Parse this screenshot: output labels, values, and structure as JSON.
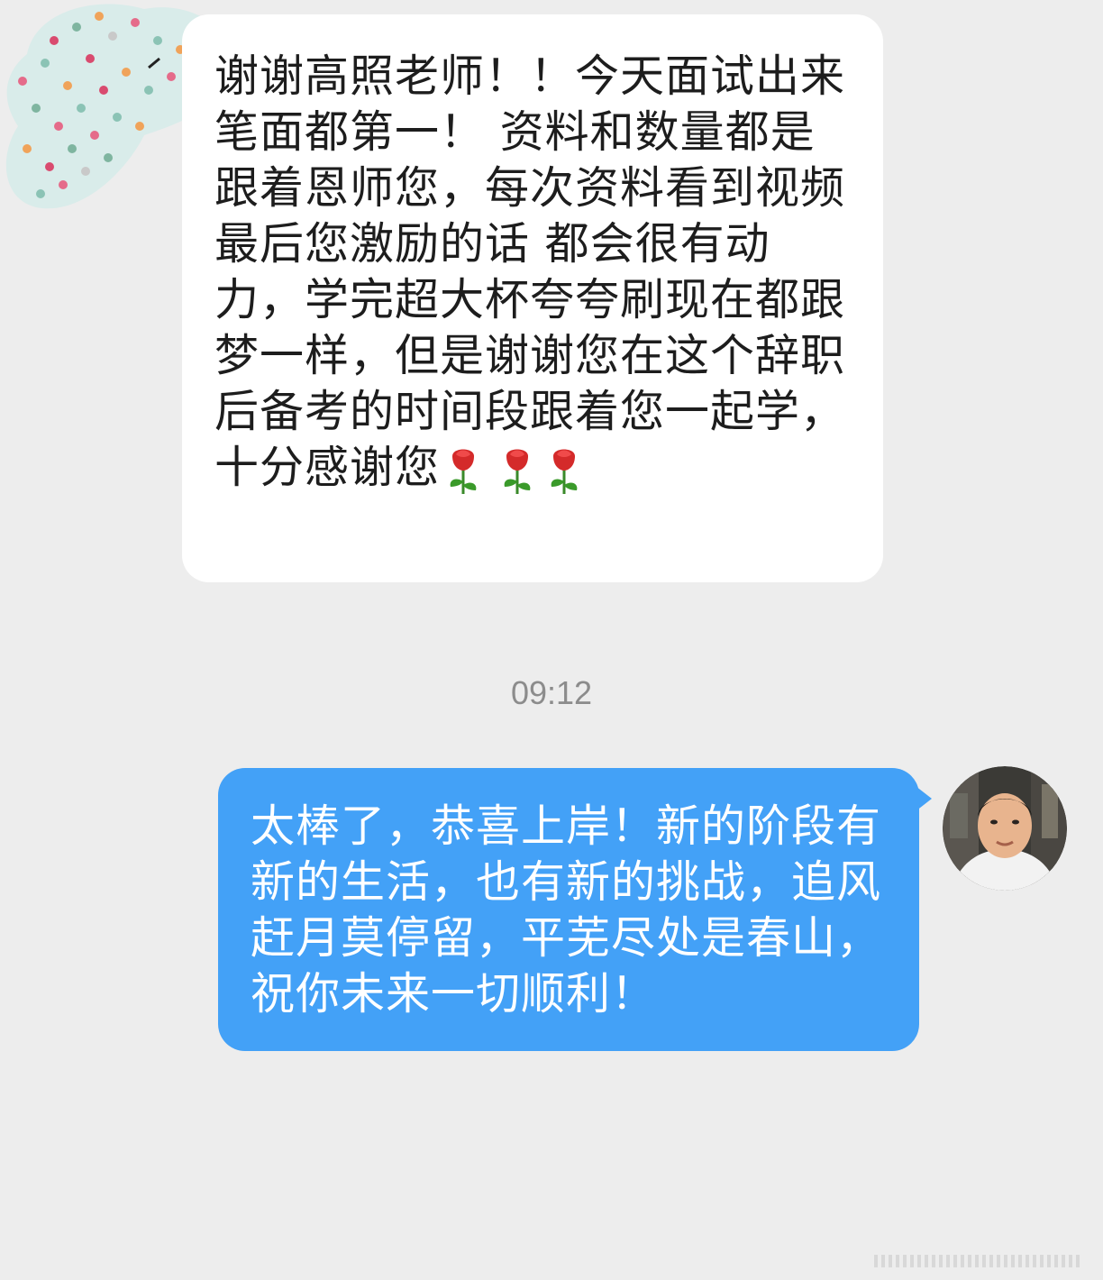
{
  "chat": {
    "incoming_message": {
      "text": "谢谢高照老师！！今天面试出来 笔面都第一！ 资料和数量都是跟着恩师您，每次资料看到视频最后您激励的话 都会很有动力，学完超大杯夸夸刷现在都跟梦一样，但是谢谢您在这个辞职后备考的时间段跟着您一起学，十分感谢您",
      "emoji": [
        "rose-emoji",
        "rose-emoji",
        "rose-emoji"
      ]
    },
    "timestamp": "09:12",
    "outgoing_message": {
      "text": "太棒了，恭喜上岸！新的阶段有新的生活，也有新的挑战，追风赶月莫停留，平芜尽处是春山，祝你未来一切顺利！"
    }
  },
  "colors": {
    "background": "#ededed",
    "incoming_bubble": "#ffffff",
    "outgoing_bubble": "#43a1f7",
    "timestamp_text": "#8c8c8c"
  }
}
